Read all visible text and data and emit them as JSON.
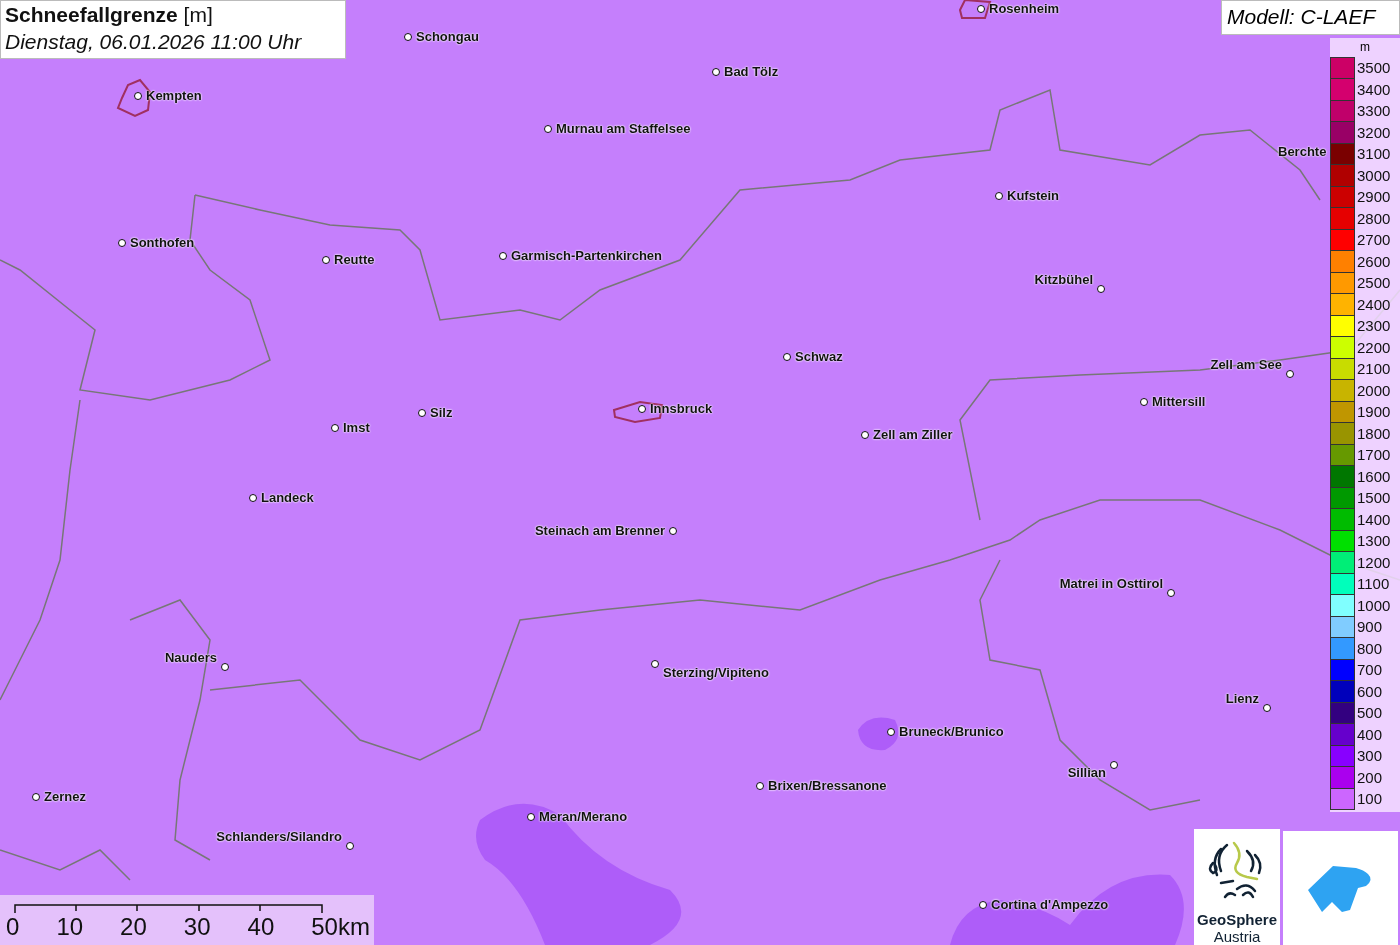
{
  "title": {
    "name": "Schneefallgrenze",
    "unit": "[m]",
    "datetime": "Dienstag, 06.01.2026 11:00 Uhr"
  },
  "model": "Modell: C-LAEF",
  "cities": [
    {
      "name": "Rosenheim"
    },
    {
      "name": "Schongau"
    },
    {
      "name": "Bad Tölz"
    },
    {
      "name": "Kempten"
    },
    {
      "name": "Murnau am Staffelsee"
    },
    {
      "name": "Berchte"
    },
    {
      "name": "Kufstein"
    },
    {
      "name": "Sonthofen"
    },
    {
      "name": "Garmisch-Partenkirchen"
    },
    {
      "name": "Reutte"
    },
    {
      "name": "Kitzbühel"
    },
    {
      "name": "Schwaz"
    },
    {
      "name": "Zell am See"
    },
    {
      "name": "Mittersill"
    },
    {
      "name": "Innsbruck"
    },
    {
      "name": "Silz"
    },
    {
      "name": "Imst"
    },
    {
      "name": "Zell am Ziller"
    },
    {
      "name": "Landeck"
    },
    {
      "name": "Steinach am Brenner"
    },
    {
      "name": "Matrei in Osttirol"
    },
    {
      "name": "Nauders"
    },
    {
      "name": "Sterzing/Vipiteno"
    },
    {
      "name": "Lienz"
    },
    {
      "name": "Bruneck/Brunico"
    },
    {
      "name": "Sillian"
    },
    {
      "name": "Brixen/Bressanone"
    },
    {
      "name": "Zernez"
    },
    {
      "name": "Meran/Merano"
    },
    {
      "name": "Schlanders/Silandro"
    },
    {
      "name": "Cortina d'Ampezzo"
    }
  ],
  "legend": {
    "unit": "m",
    "items": [
      {
        "label": "3500",
        "color": "#cc0066"
      },
      {
        "label": "3400",
        "color": "#d4006e"
      },
      {
        "label": "3300",
        "color": "#c0006a"
      },
      {
        "label": "3200",
        "color": "#990066"
      },
      {
        "label": "3100",
        "color": "#7a0000"
      },
      {
        "label": "3000",
        "color": "#b00000"
      },
      {
        "label": "2900",
        "color": "#cc0000"
      },
      {
        "label": "2800",
        "color": "#e60000"
      },
      {
        "label": "2700",
        "color": "#ff0000"
      },
      {
        "label": "2600",
        "color": "#ff8000"
      },
      {
        "label": "2500",
        "color": "#ff9900"
      },
      {
        "label": "2400",
        "color": "#ffb300"
      },
      {
        "label": "2300",
        "color": "#ffff00"
      },
      {
        "label": "2200",
        "color": "#ccff00"
      },
      {
        "label": "2100",
        "color": "#c8dc00"
      },
      {
        "label": "2000",
        "color": "#c8b400"
      },
      {
        "label": "1900",
        "color": "#c09600"
      },
      {
        "label": "1800",
        "color": "#999400"
      },
      {
        "label": "1700",
        "color": "#669900"
      },
      {
        "label": "1600",
        "color": "#007700"
      },
      {
        "label": "1500",
        "color": "#009900"
      },
      {
        "label": "1400",
        "color": "#00bb00"
      },
      {
        "label": "1300",
        "color": "#00e000"
      },
      {
        "label": "1200",
        "color": "#00ee77"
      },
      {
        "label": "1100",
        "color": "#00ffbb"
      },
      {
        "label": "1000",
        "color": "#80ffff"
      },
      {
        "label": "900",
        "color": "#80ccff"
      },
      {
        "label": "800",
        "color": "#3399ff"
      },
      {
        "label": "700",
        "color": "#0000ff"
      },
      {
        "label": "600",
        "color": "#0000bb"
      },
      {
        "label": "500",
        "color": "#330080"
      },
      {
        "label": "400",
        "color": "#6600cc"
      },
      {
        "label": "300",
        "color": "#8800ff"
      },
      {
        "label": "200",
        "color": "#aa00ee"
      },
      {
        "label": "100",
        "color": "#cc66ff"
      }
    ]
  },
  "scale_bar": {
    "ticks": [
      "0",
      "10",
      "20",
      "30",
      "40",
      "50km"
    ]
  },
  "logos": {
    "geosphere": {
      "line1": "GeoSphere",
      "line2": "Austria"
    }
  }
}
